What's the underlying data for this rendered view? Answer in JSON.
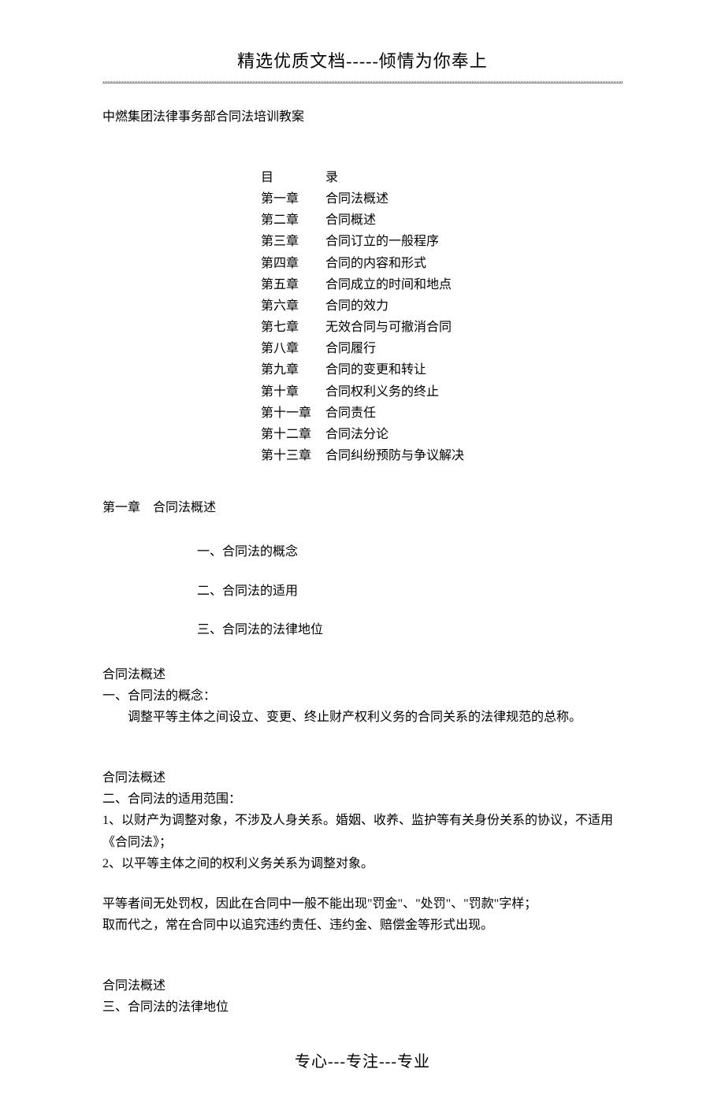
{
  "header": "精选优质文档-----倾情为你奉上",
  "doc_title": "中燃集团法律事务部合同法培训教案",
  "toc_header_left": "目",
  "toc_header_right": "录",
  "toc": [
    {
      "chap": "第一章",
      "title": "合同法概述"
    },
    {
      "chap": "第二章",
      "title": "合同概述"
    },
    {
      "chap": "第三章",
      "title": "合同订立的一般程序"
    },
    {
      "chap": "第四章",
      "title": "合同的内容和形式"
    },
    {
      "chap": "第五章",
      "title": "合同成立的时间和地点"
    },
    {
      "chap": "第六章",
      "title": "合同的效力"
    },
    {
      "chap": "第七章",
      "title": "无效合同与可撤消合同"
    },
    {
      "chap": "第八章",
      "title": "合同履行"
    },
    {
      "chap": "第九章",
      "title": "合同的变更和转让"
    },
    {
      "chap": "第十章",
      "title": "合同权利义务的终止"
    },
    {
      "chap": "第十一章",
      "title": "合同责任"
    },
    {
      "chap": "第十二章",
      "title": "合同法分论"
    },
    {
      "chap": "第十三章",
      "title": "合同纠纷预防与争议解决"
    }
  ],
  "ch1_heading": "第一章　合同法概述",
  "ch1_points": [
    "一、合同法的概念",
    "二、合同法的适用",
    "三、合同法的法律地位"
  ],
  "block1": {
    "h": "合同法概述",
    "sub": "一、合同法的概念：",
    "body": "调整平等主体之间设立、变更、终止财产权利义务的合同关系的法律规范的总称。"
  },
  "block2": {
    "h": "合同法概述",
    "sub": "二、合同法的适用范围：",
    "l1": "1、以财产为调整对象，不涉及人身关系。婚姻、收养、监护等有关身份关系的协议，不适用《合同法》；",
    "l2": "2、以平等主体之间的权利义务关系为调整对象。"
  },
  "block3": {
    "l1": "平等者间无处罚权，因此在合同中一般不能出现\"罚金\"、\"处罚\"、\"罚款\"字样；",
    "l2": "取而代之，常在合同中以追究违约责任、违约金、赔偿金等形式出现。"
  },
  "block4": {
    "h": "合同法概述",
    "sub": "三、合同法的法律地位"
  },
  "footer": "专心---专注---专业"
}
